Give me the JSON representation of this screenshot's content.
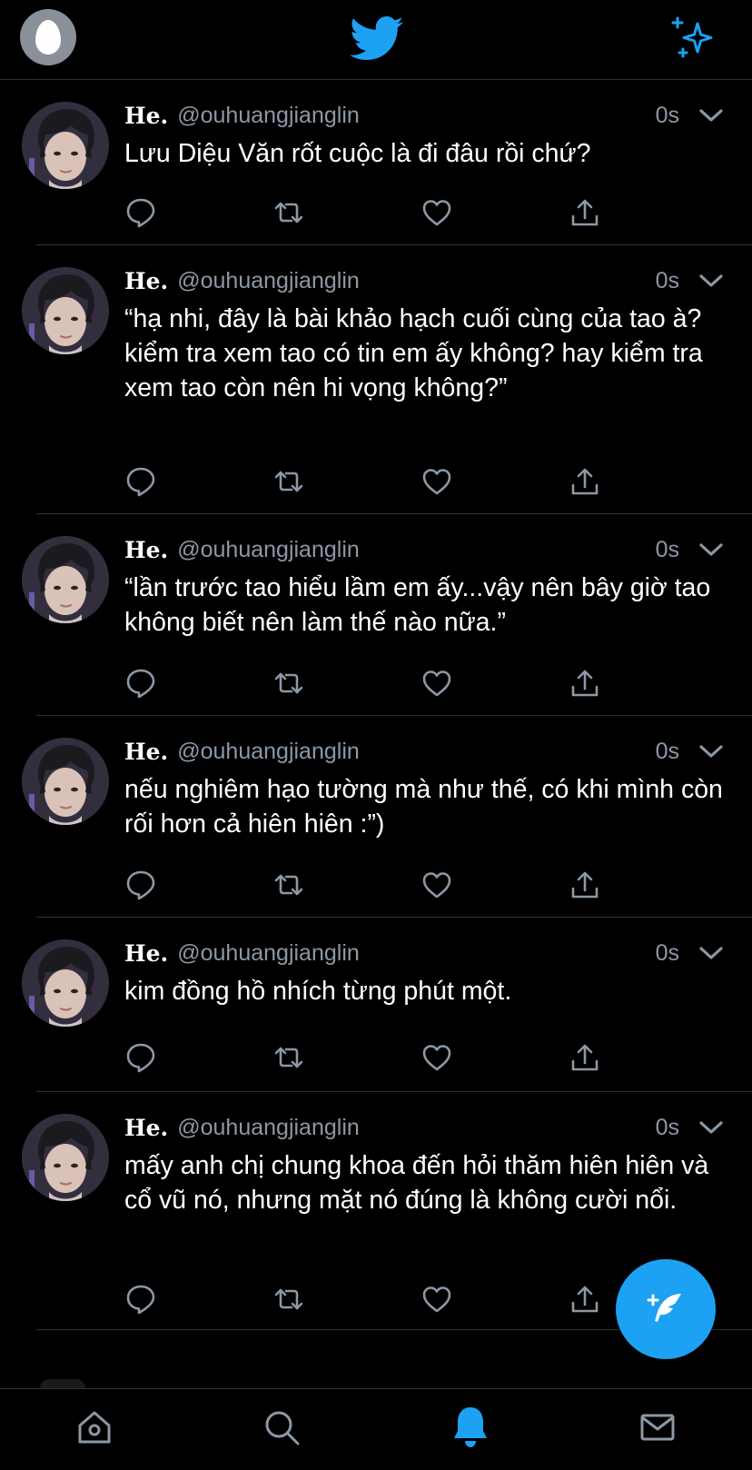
{
  "colors": {
    "background": "#000000",
    "accent": "#1da1f2",
    "muted": "#8b98a5",
    "divider": "#2f3336"
  },
  "header": {
    "profile_icon": "egg-avatar-icon",
    "logo_icon": "twitter-bird-icon",
    "sparkle_icon": "sparkle-icon"
  },
  "tweets": [
    {
      "name": "He.",
      "handle": "@ouhuangjianglin",
      "time": "0s",
      "text": "Lưu Diệu Văn rốt cuộc là đi đâu rồi chứ?"
    },
    {
      "name": "He.",
      "handle": "@ouhuangjianglin",
      "time": "0s",
      "text": "“hạ nhi, đây là bài khảo hạch cuối cùng của tao à? kiểm tra xem tao có tin em ấy không? hay kiểm tra xem tao còn nên hi vọng không?”"
    },
    {
      "name": "He.",
      "handle": "@ouhuangjianglin",
      "time": "0s",
      "text": "“lần trước tao hiểu lầm em ấy...vậy nên bây giờ tao không biết nên làm thế nào nữa.”"
    },
    {
      "name": "He.",
      "handle": "@ouhuangjianglin",
      "time": "0s",
      "text": "nếu nghiêm hạo tường mà như thế, có khi mình còn rối hơn cả hiên hiên :”)"
    },
    {
      "name": "He.",
      "handle": "@ouhuangjianglin",
      "time": "0s",
      "text": "kim đồng hồ nhích từng phút một."
    },
    {
      "name": "He.",
      "handle": "@ouhuangjianglin",
      "time": "0s",
      "text": "mấy anh chị chung khoa đến hỏi thăm hiên hiên và cổ vũ nó, nhưng mặt nó đúng là không cười nổi."
    }
  ],
  "bottom_nav": {
    "items": [
      "home-icon",
      "search-icon",
      "notifications-icon",
      "messages-icon"
    ],
    "active": "notifications-icon"
  }
}
